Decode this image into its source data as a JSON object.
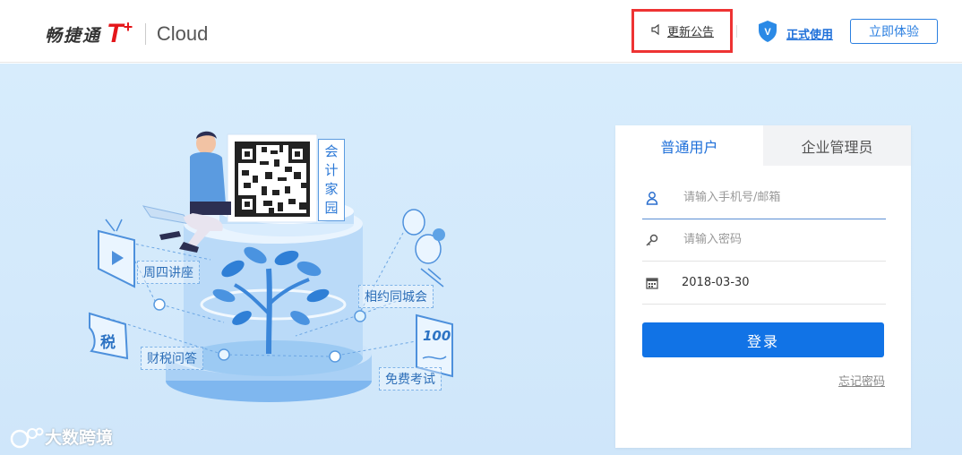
{
  "header": {
    "logo_cn": "畅捷通",
    "logo_t": "T",
    "logo_plus": "+",
    "logo_cloud": "Cloud",
    "notice_label": "更新公告",
    "formal_label": "正式使用",
    "formal_badge": "V",
    "trial_label": "立即体验"
  },
  "hero": {
    "qr_label": "会计家园",
    "labels": {
      "thursday": "周四讲座",
      "tax_qa": "财税问答",
      "meetup": "相约同城会",
      "exam": "免费考试",
      "tax_char": "税",
      "score": "100"
    }
  },
  "watermark": "大数跨境",
  "login": {
    "tabs": [
      {
        "label": "普通用户",
        "active": true
      },
      {
        "label": "企业管理员",
        "active": false
      }
    ],
    "account_placeholder": "请输入手机号/邮箱",
    "password_placeholder": "请输入密码",
    "date_value": "2018-03-30",
    "submit_label": "登录",
    "forgot_label": "忘记密码"
  },
  "colors": {
    "brand_red": "#e4161a",
    "primary_blue": "#1173e6",
    "hero_bg": "#d5eafb"
  }
}
